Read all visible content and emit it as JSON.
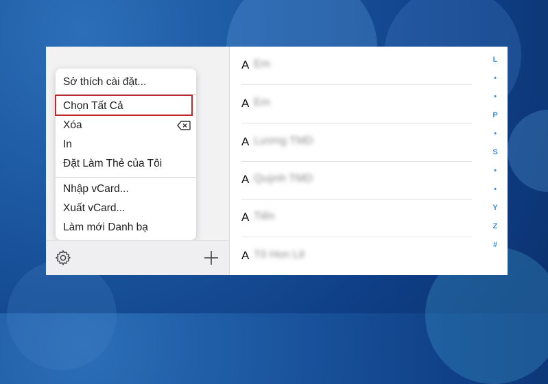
{
  "menu": {
    "items": [
      {
        "label": "Sở thích cài đặt..."
      },
      {
        "label": "Chọn Tất Cả"
      },
      {
        "label": "Xóa"
      },
      {
        "label": "In"
      },
      {
        "label": "Đặt Làm Thẻ của Tôi"
      },
      {
        "label": "Nhập vCard..."
      },
      {
        "label": "Xuất vCard..."
      },
      {
        "label": "Làm mới Danh bạ"
      }
    ],
    "highlighted": "Chọn Tất Cả",
    "highlight_color": "#c0272d"
  },
  "toolbar": {
    "settings_icon": "gear-icon",
    "add_icon": "plus-icon"
  },
  "contacts": [
    {
      "letter": "A",
      "name": "Em"
    },
    {
      "letter": "A",
      "name": "Em"
    },
    {
      "letter": "A",
      "name": "Lương TMD"
    },
    {
      "letter": "A",
      "name": "Quỳnh TMD"
    },
    {
      "letter": "A",
      "name": "Tiến"
    },
    {
      "letter": "A",
      "name": "Tô Hon Lê"
    }
  ],
  "index": [
    "L",
    "•",
    "•",
    "P",
    "•",
    "S",
    "•",
    "•",
    "Y",
    "Z",
    "#"
  ],
  "colors": {
    "accent": "#3d8de0",
    "background": "#1d5aa3"
  }
}
